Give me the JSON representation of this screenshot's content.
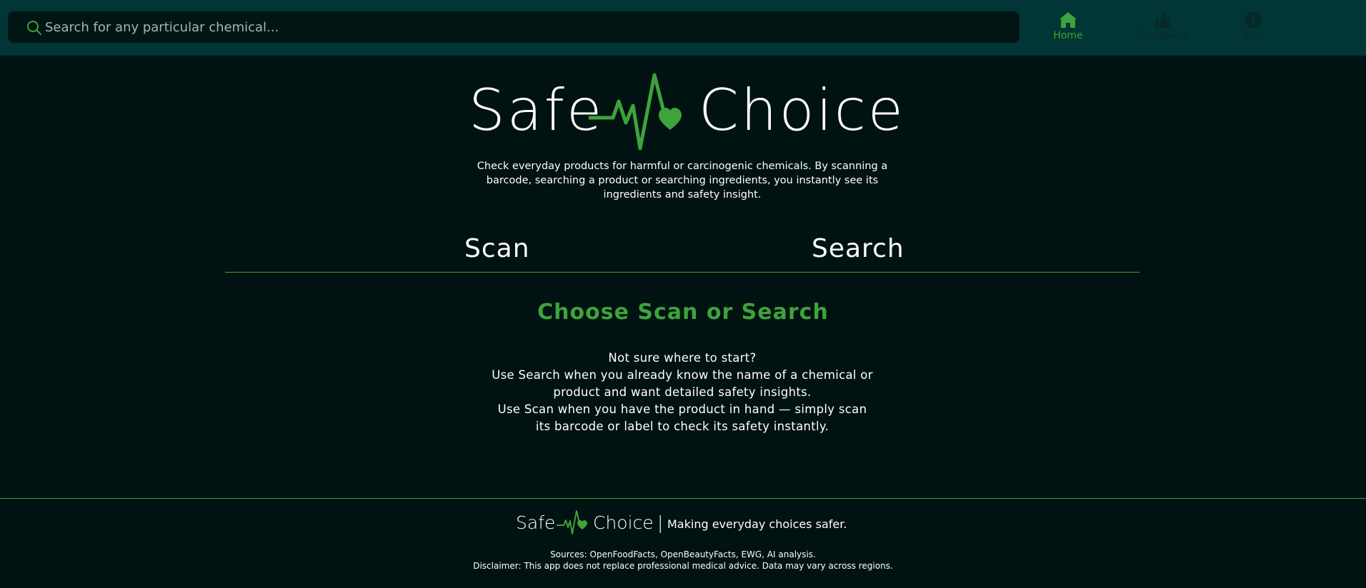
{
  "search": {
    "placeholder": "Search for any particular chemical..."
  },
  "nav": {
    "items": [
      {
        "label": "Home",
        "icon": "home-icon",
        "active": true
      },
      {
        "label": "Feedback",
        "icon": "thumbs-up-icon",
        "active": false
      },
      {
        "label": "Info",
        "icon": "info-icon",
        "active": false
      }
    ]
  },
  "logo": {
    "left": "Safe",
    "right": "Choice"
  },
  "intro": "Check everyday products for harmful or carcinogenic chemicals. By scanning a barcode, searching a product or searching ingredients, you instantly see its ingredients and safety insight.",
  "tabs": {
    "scan": "Scan",
    "search": "Search"
  },
  "main": {
    "heading": "Choose Scan or Search",
    "help_lines": [
      "Not sure where to start?",
      "Use Search when you already know the name of a chemical or",
      "product and want detailed safety insights.",
      "Use Scan when you have the product in hand — simply scan",
      "its barcode or label to check its safety instantly."
    ]
  },
  "footer": {
    "logo_left": "Safe",
    "logo_right": "Choice",
    "separator": "|",
    "tagline": "Making everyday choices safer.",
    "sources": "Sources: OpenFoodFacts, OpenBeautyFacts, EWG, AI analysis.",
    "disclaimer": "Disclaimer: This app does not replace professional medical advice. Data may vary across regions."
  },
  "colors": {
    "background": "#011212",
    "topbar": "#023535",
    "accent": "#3ea33a",
    "text": "#ffffff"
  }
}
